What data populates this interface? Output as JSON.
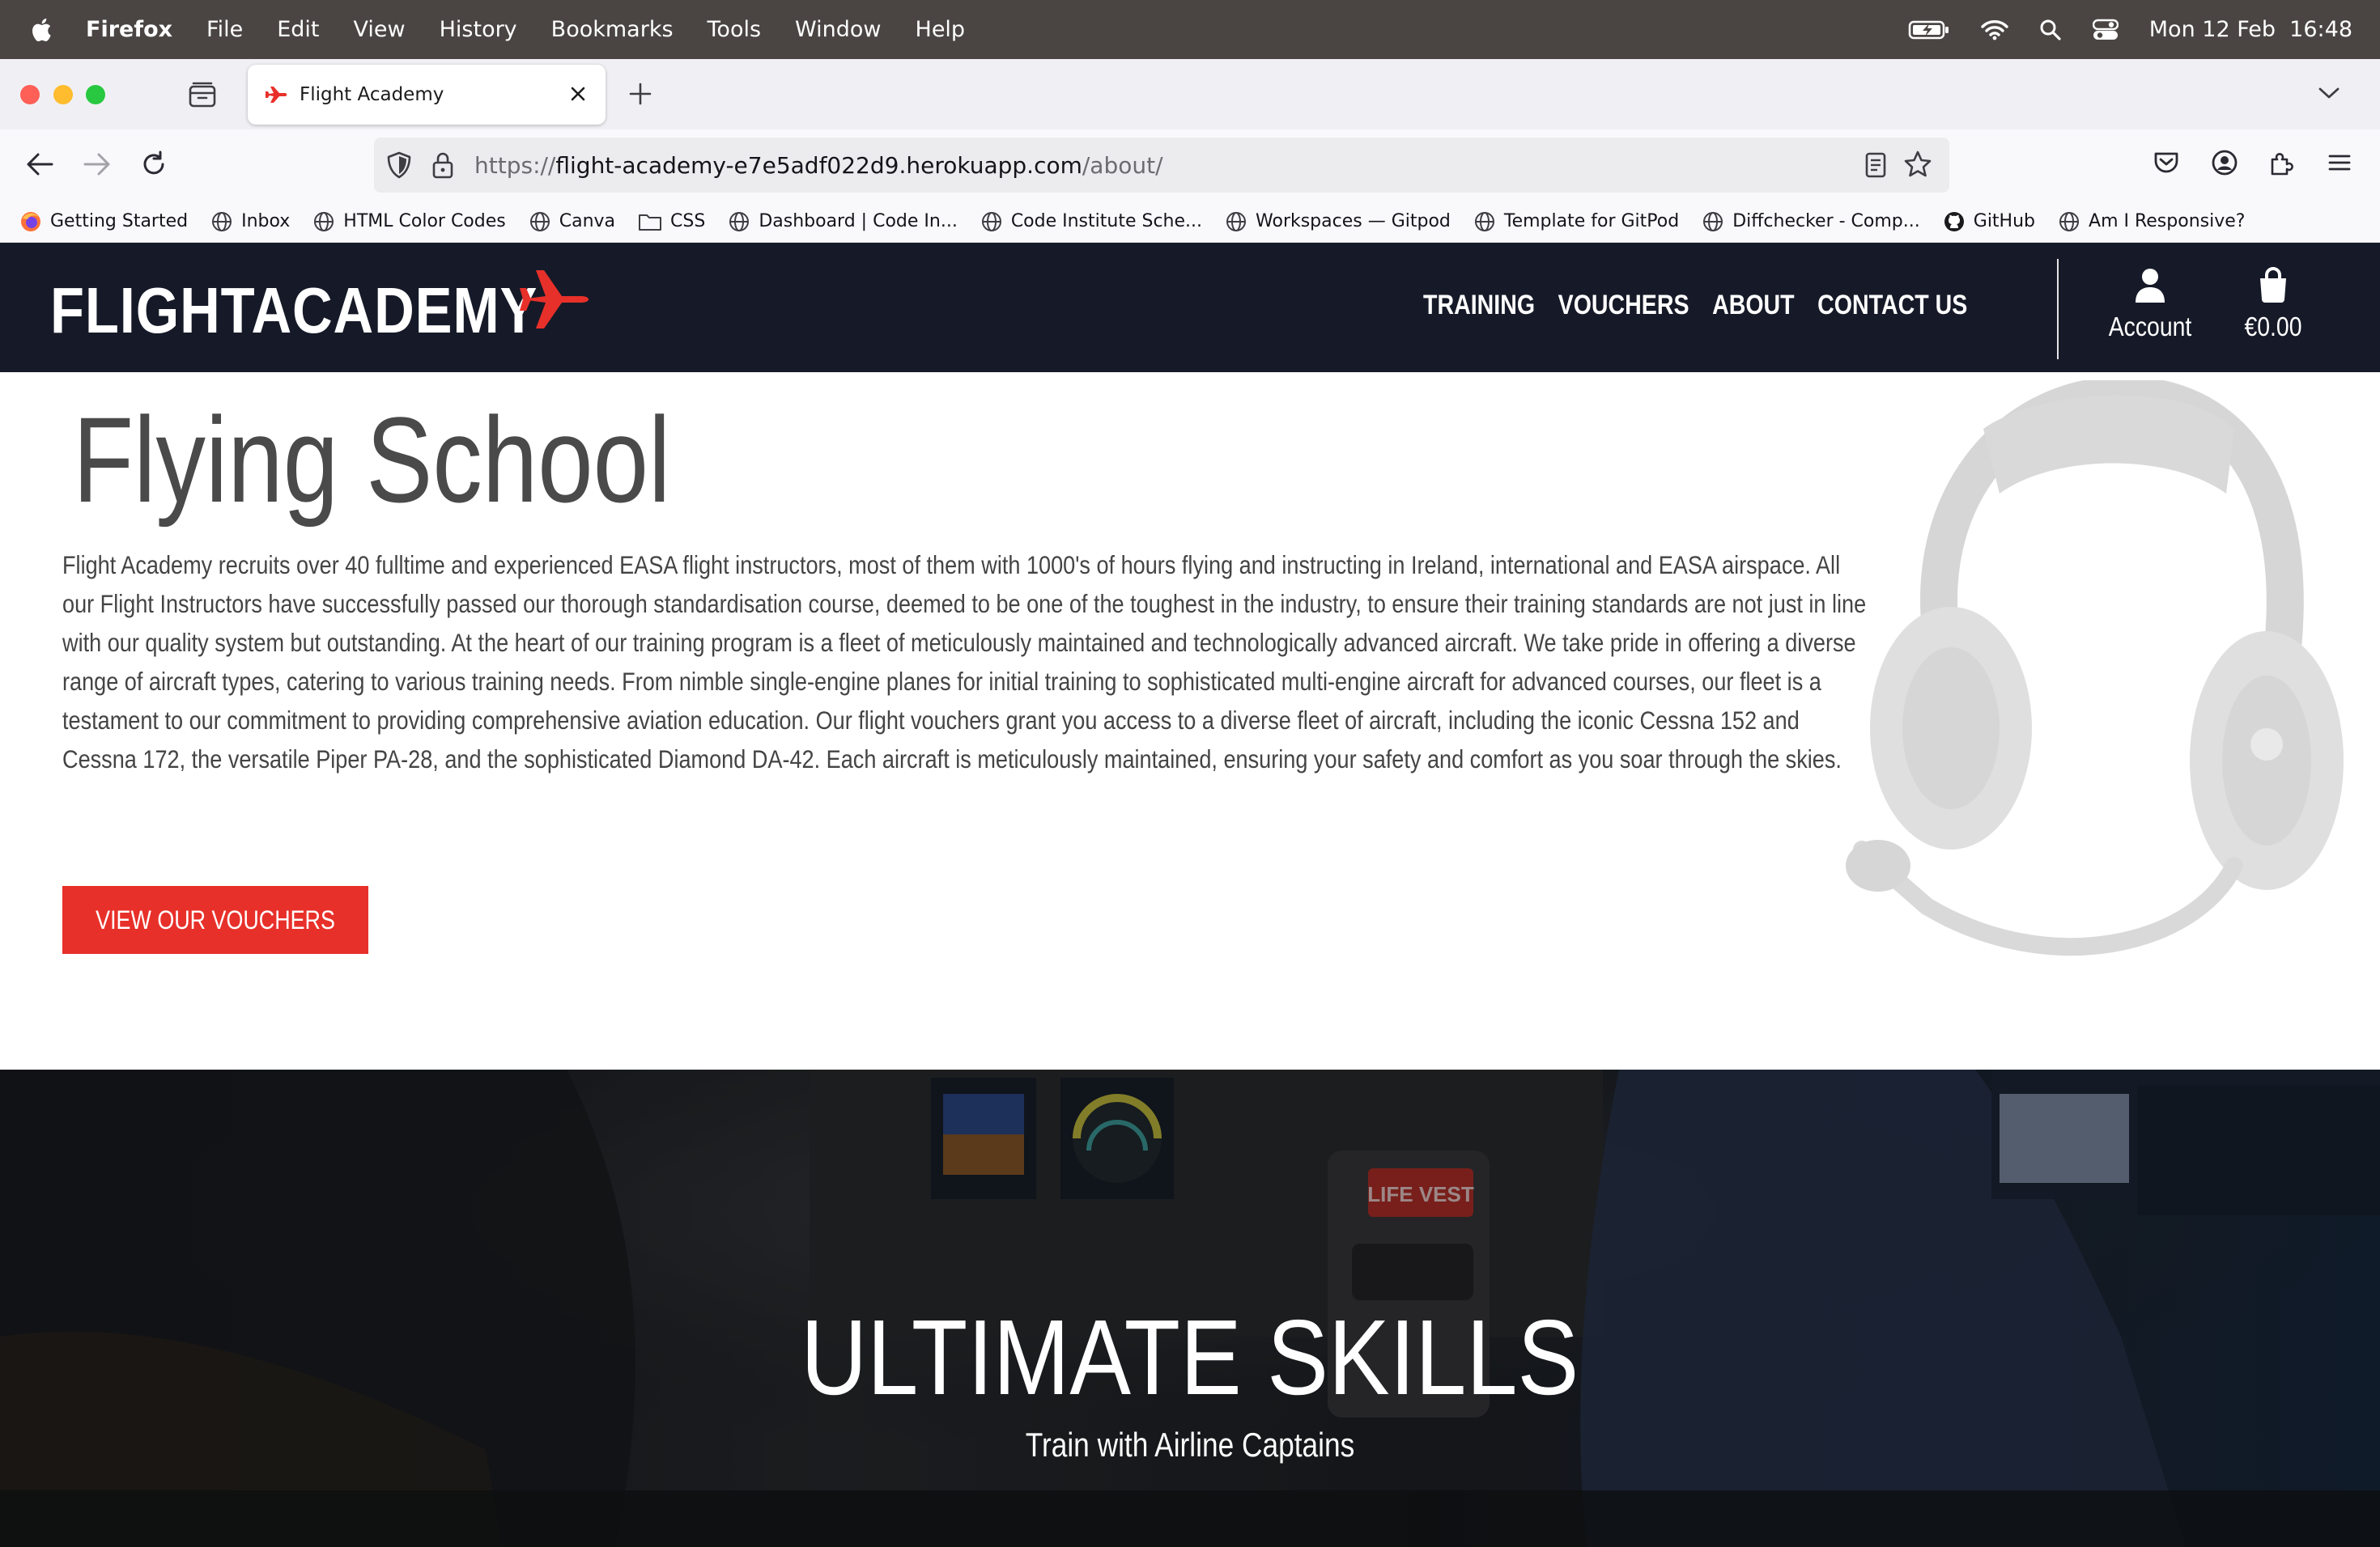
{
  "os_menubar": {
    "app_name": "Firefox",
    "items": [
      "File",
      "Edit",
      "View",
      "History",
      "Bookmarks",
      "Tools",
      "Window",
      "Help"
    ],
    "clock": "Mon 12 Feb  16:48"
  },
  "browser": {
    "tab_title": "Flight Academy",
    "url_protocol": "https://",
    "url_host": "flight-academy-e7e5adf022d9.herokuapp.com",
    "url_path": "/about/",
    "bookmarks": [
      {
        "label": "Getting Started",
        "icon": "firefox-icon"
      },
      {
        "label": "Inbox",
        "icon": "globe-icon"
      },
      {
        "label": "HTML Color Codes",
        "icon": "globe-icon"
      },
      {
        "label": "Canva",
        "icon": "globe-icon"
      },
      {
        "label": "CSS",
        "icon": "folder-icon"
      },
      {
        "label": "Dashboard | Code In...",
        "icon": "globe-icon"
      },
      {
        "label": "Code Institute Sche...",
        "icon": "globe-icon"
      },
      {
        "label": "Workspaces — Gitpod",
        "icon": "globe-icon"
      },
      {
        "label": "Template for GitPod",
        "icon": "globe-icon"
      },
      {
        "label": "Diffchecker - Comp...",
        "icon": "globe-icon"
      },
      {
        "label": "GitHub",
        "icon": "github-icon"
      },
      {
        "label": "Am I Responsive?",
        "icon": "globe-icon"
      }
    ]
  },
  "site": {
    "logo_text": "FLIGHTACADEMY",
    "brand_color": "#e8302a",
    "header_color": "#161a28",
    "nav": [
      "TRAINING",
      "VOUCHERS",
      "ABOUT",
      "CONTACT US"
    ],
    "account_label": "Account",
    "bag_total": "€0.00"
  },
  "about": {
    "title": "Flying School",
    "body": "Flight Academy recruits over 40 fulltime and experienced EASA flight instructors, most of them with 1000's of hours flying and instructing in Ireland, international and EASA airspace. All our Flight Instructors have successfully passed our thorough standardisation course, deemed to be one of the toughest in the industry, to ensure their training standards are not just in line with our quality system but outstanding. At the heart of our training program is a fleet of meticulously maintained and technologically advanced aircraft. We take pride in offering a diverse range of aircraft types, catering to various training needs. From nimble single-engine planes for initial training to sophisticated multi-engine aircraft for advanced courses, our fleet is a testament to our commitment to providing comprehensive aviation education. Our flight vouchers grant you access to a diverse fleet of aircraft, including the iconic Cessna 152 and Cessna 172, the versatile Piper PA-28, and the sophisticated Diamond DA-42. Each aircraft is meticulously maintained, ensuring your safety and comfort as you soar through the skies.",
    "cta_label": "VIEW OUR VOUCHERS"
  },
  "hero": {
    "title": "ULTIMATE SKILLS",
    "subtitle": "Train with Airline Captains",
    "sign_text": "LIFE VEST"
  }
}
